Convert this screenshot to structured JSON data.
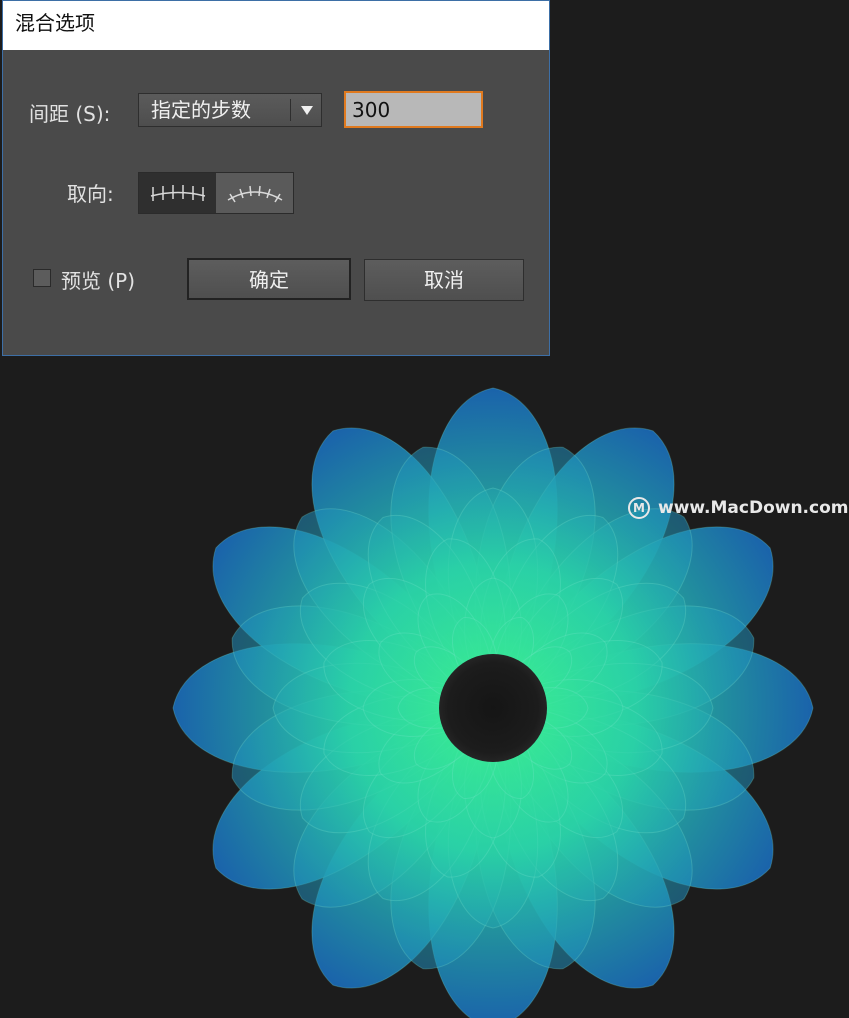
{
  "dialog": {
    "title": "混合选项",
    "spacing_label": "间距 (S):",
    "spacing_option": "指定的步数",
    "steps_value": "300",
    "orientation_label": "取向:",
    "preview_label": "预览 (P)",
    "ok_label": "确定",
    "cancel_label": "取消",
    "preview_checked": false
  },
  "watermark": {
    "logo": "M",
    "text": "www.MacDown.com"
  },
  "colors": {
    "dialog_bg": "#4a4a4a",
    "canvas_bg": "#1c1c1c",
    "input_border": "#e07a1f",
    "flower_outer": "#1f7fc9",
    "flower_inner": "#33e08f"
  },
  "icons": {
    "orientation_align_page": "align-to-page-icon",
    "orientation_align_path": "align-to-path-icon",
    "dropdown": "chevron-down-icon"
  }
}
